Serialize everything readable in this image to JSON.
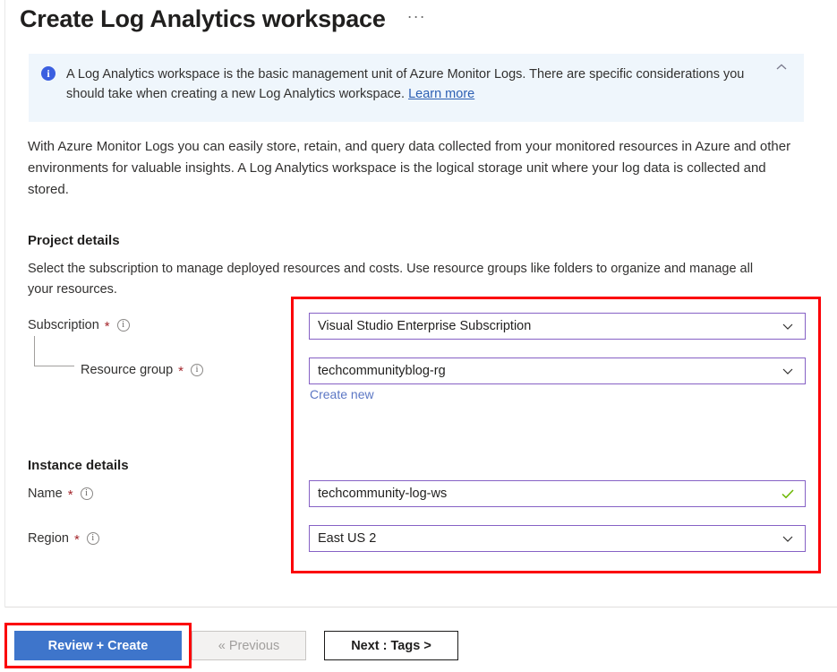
{
  "header": {
    "title": "Create Log Analytics workspace",
    "more_menu": "···",
    "more_menu_name": "more-options"
  },
  "banner": {
    "icon": "info-icon",
    "text": "A Log Analytics workspace is the basic management unit of Azure Monitor Logs. There are specific considerations you should take when creating a new Log Analytics workspace. ",
    "link_label": "Learn more",
    "collapse_icon": "chevron-up-icon",
    "background": "#eff6fc",
    "icon_color": "#3b5fe0"
  },
  "intro": {
    "text": "With Azure Monitor Logs you can easily store, retain, and query data collected from your monitored resources in Azure and other environments for valuable insights. A Log Analytics workspace is the logical storage unit where your log data is collected and stored."
  },
  "project_details": {
    "heading": "Project details",
    "description": "Select the subscription to manage deployed resources and costs. Use resource groups like folders to organize and manage all your resources.",
    "fields": [
      {
        "label": "Subscription",
        "required": "*",
        "info": "ⓘ",
        "value": "Visual Studio Enterprise Subscription",
        "control": "dropdown"
      },
      {
        "label": "Resource group",
        "required": "*",
        "info": "ⓘ",
        "value": "techcommunityblog-rg",
        "control": "dropdown",
        "sub_link": "Create new"
      }
    ]
  },
  "instance_details": {
    "heading": "Instance details",
    "fields": [
      {
        "label": "Name",
        "required": "*",
        "info": "ⓘ",
        "value": "techcommunity-log-ws",
        "control": "textbox",
        "validation": "valid"
      },
      {
        "label": "Region",
        "required": "*",
        "info": "ⓘ",
        "value": "East US 2",
        "control": "dropdown"
      }
    ]
  },
  "footer": {
    "review_create": "Review + Create",
    "previous": "« Previous",
    "next": "Next : Tags >"
  },
  "annotations": {
    "color": "#fb0007",
    "regions": [
      "form-fields-group",
      "review-create-button"
    ]
  },
  "colors": {
    "accent_blue": "#3e75cb",
    "field_border_purple": "#8661c5",
    "link_blue": "#5c77c4",
    "required_red": "#a4262c",
    "valid_green": "#6bb700",
    "annotation_red": "#fb0007"
  }
}
